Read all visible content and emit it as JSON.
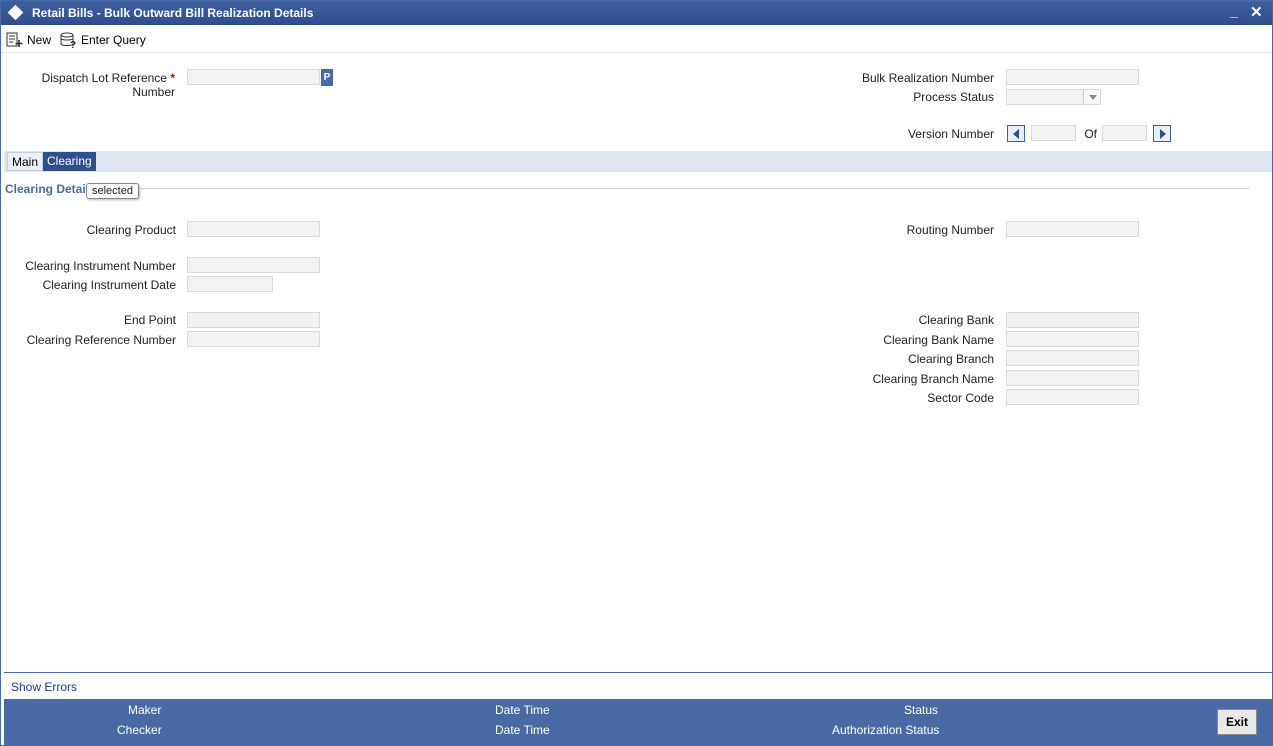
{
  "window": {
    "title": "Retail Bills - Bulk Outward Bill Realization Details",
    "minimize": "_",
    "close": "✕"
  },
  "toolbar": {
    "new_label": "New",
    "enter_query_label": "Enter Query"
  },
  "header": {
    "dispatch_lot_label_line1": "Dispatch Lot Reference",
    "dispatch_lot_label_line2": "Number",
    "required_marker": "*",
    "p_button": "P",
    "bulk_realization_label": "Bulk Realization Number",
    "process_status_label": "Process Status",
    "version_number_label": "Version Number",
    "of_label": "Of"
  },
  "tabs": [
    {
      "label": "Main"
    },
    {
      "label": "Clearing"
    }
  ],
  "clearing": {
    "section_title": "Clearing Detai",
    "tooltip": "selected",
    "clearing_product": "Clearing Product",
    "routing_number": "Routing Number",
    "clearing_instrument_number": "Clearing Instrument Number",
    "clearing_instrument_date": "Clearing Instrument Date",
    "end_point": "End Point",
    "clearing_reference_number": "Clearing Reference Number",
    "clearing_bank": "Clearing Bank",
    "clearing_bank_name": "Clearing Bank Name",
    "clearing_branch": "Clearing Branch",
    "clearing_branch_name": "Clearing Branch Name",
    "sector_code": "Sector Code"
  },
  "errors": {
    "show_errors": "Show Errors"
  },
  "footer": {
    "maker": "Maker",
    "checker": "Checker",
    "date_time_1": "Date Time",
    "date_time_2": "Date Time",
    "status": "Status",
    "authorization_status": "Authorization Status",
    "exit": "Exit"
  },
  "colors": {
    "accent": "#4a6aa5",
    "title_bar": "#2f4f8c",
    "section": "#4a6aa5"
  }
}
